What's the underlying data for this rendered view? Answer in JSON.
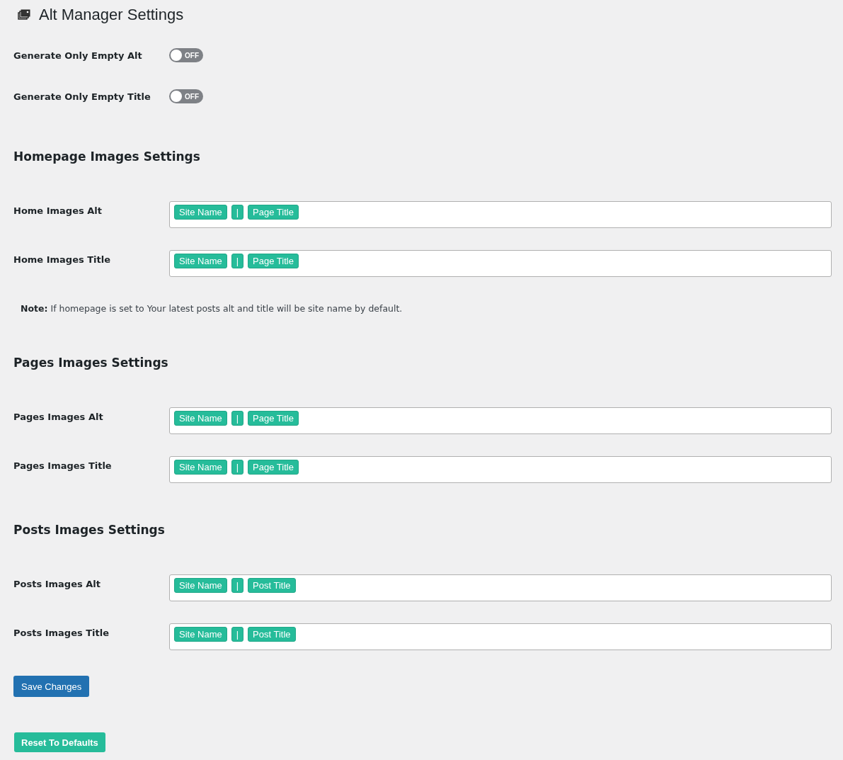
{
  "title": "Alt Manager Settings",
  "toggles": [
    {
      "label": "Generate Only Empty Alt",
      "on": false,
      "text": "OFF"
    },
    {
      "label": "Generate Only Empty Title",
      "on": false,
      "text": "OFF"
    }
  ],
  "sections": [
    {
      "heading": "Homepage Images Settings",
      "fields": [
        {
          "label": "Home Images Alt",
          "tags": [
            "Site Name",
            "|",
            "Page Title"
          ]
        },
        {
          "label": "Home Images Title",
          "tags": [
            "Site Name",
            "|",
            "Page Title"
          ]
        }
      ],
      "note": {
        "label": "Note:",
        "text": "If homepage is set to Your latest posts alt and title will be site name by default."
      }
    },
    {
      "heading": "Pages Images Settings",
      "fields": [
        {
          "label": "Pages Images Alt",
          "tags": [
            "Site Name",
            "|",
            "Page Title"
          ]
        },
        {
          "label": "Pages Images Title",
          "tags": [
            "Site Name",
            "|",
            "Page Title"
          ]
        }
      ]
    },
    {
      "heading": "Posts Images Settings",
      "fields": [
        {
          "label": "Posts Images Alt",
          "tags": [
            "Site Name",
            "|",
            "Post Title"
          ]
        },
        {
          "label": "Posts Images Title",
          "tags": [
            "Site Name",
            "|",
            "Post Title"
          ]
        }
      ]
    }
  ],
  "buttons": [
    {
      "label": "Save Changes",
      "kind": "primary"
    },
    {
      "label": "Reset To Defaults",
      "kind": "reset"
    }
  ]
}
